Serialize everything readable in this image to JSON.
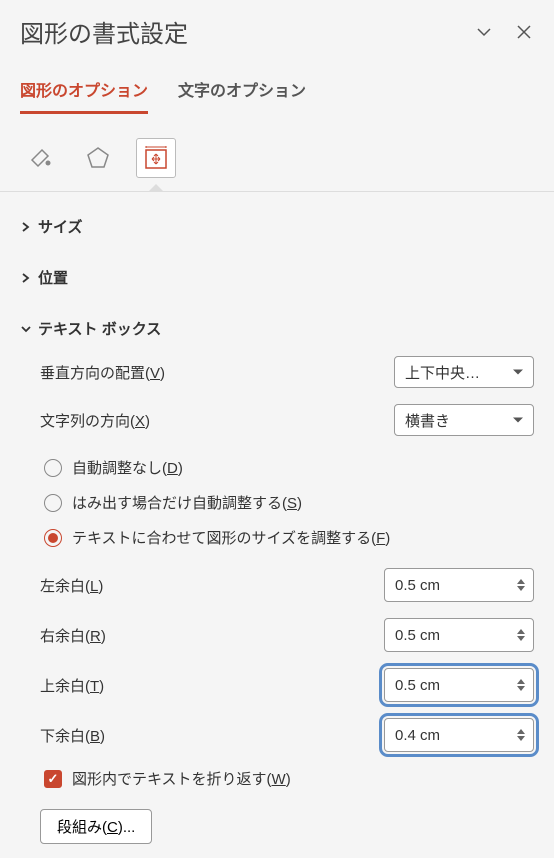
{
  "header": {
    "title": "図形の書式設定"
  },
  "tabs": {
    "shape_options": "図形のオプション",
    "text_options": "文字のオプション"
  },
  "sections": {
    "size": "サイズ",
    "position": "位置",
    "textbox": "テキスト ボックス"
  },
  "textbox": {
    "valign_label": "垂直方向の配置(",
    "valign_key": "V",
    "valign_suffix": ")",
    "valign_value": "上下中央…",
    "textdir_label": "文字列の方向(",
    "textdir_key": "X",
    "textdir_suffix": ")",
    "textdir_value": "横書き",
    "radio1_label": "自動調整なし(",
    "radio1_key": "D",
    "radio1_suffix": ")",
    "radio2_label": "はみ出す場合だけ自動調整する(",
    "radio2_key": "S",
    "radio2_suffix": ")",
    "radio3_label": "テキストに合わせて図形のサイズを調整する(",
    "radio3_key": "F",
    "radio3_suffix": ")",
    "left_margin_label": "左余白(",
    "left_margin_key": "L",
    "left_margin_suffix": ")",
    "left_margin_value": "0.5 cm",
    "right_margin_label": "右余白(",
    "right_margin_key": "R",
    "right_margin_suffix": ")",
    "right_margin_value": "0.5 cm",
    "top_margin_label": "上余白(",
    "top_margin_key": "T",
    "top_margin_suffix": ")",
    "top_margin_value": "0.5 cm",
    "bottom_margin_label": "下余白(",
    "bottom_margin_key": "B",
    "bottom_margin_suffix": ")",
    "bottom_margin_value": "0.4 cm",
    "wrap_label": "図形内でテキストを折り返す(",
    "wrap_key": "W",
    "wrap_suffix": ")",
    "columns_button": "段組み(",
    "columns_key": "C",
    "columns_suffix": ")..."
  }
}
